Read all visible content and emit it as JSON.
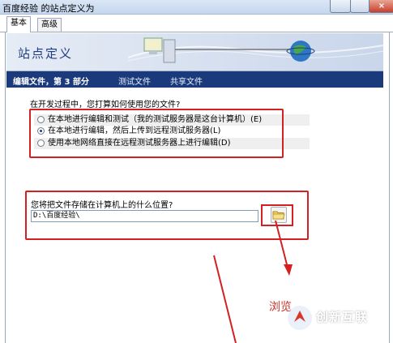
{
  "window": {
    "title": "百度经验 的站点定义为",
    "close_glyph": "×"
  },
  "tabs": [
    {
      "label": "基本"
    },
    {
      "label": "高级"
    }
  ],
  "header": {
    "title": "站点定义"
  },
  "step_bar": {
    "current": "编辑文件，第 3 部分",
    "step2": "测试文件",
    "step3": "共享文件"
  },
  "question1": {
    "text": "在开发过程中，您打算如何使用您的文件?"
  },
  "options": [
    {
      "label": "在本地进行编辑和测试（我的测试服务器是这台计算机）(E)",
      "selected": false
    },
    {
      "label": "在本地进行编辑，然后上传到远程测试服务器(L)",
      "selected": true
    },
    {
      "label": "使用本地网络直接在远程测试服务器上进行编辑(D)",
      "selected": false
    }
  ],
  "question2": {
    "text": "您将把文件存储在计算机上的什么位置?"
  },
  "path_field": {
    "value": "D:\\百度经验\\"
  },
  "annotation": {
    "text": "浏览"
  },
  "watermark": {
    "text": "创新互联"
  },
  "colors": {
    "step_bar": "#1b3a7c",
    "highlight": "#d42020",
    "header_title": "#203c80"
  },
  "icons": {
    "folder": "folder-icon",
    "network": "network-icon",
    "globe": "globe-icon"
  }
}
